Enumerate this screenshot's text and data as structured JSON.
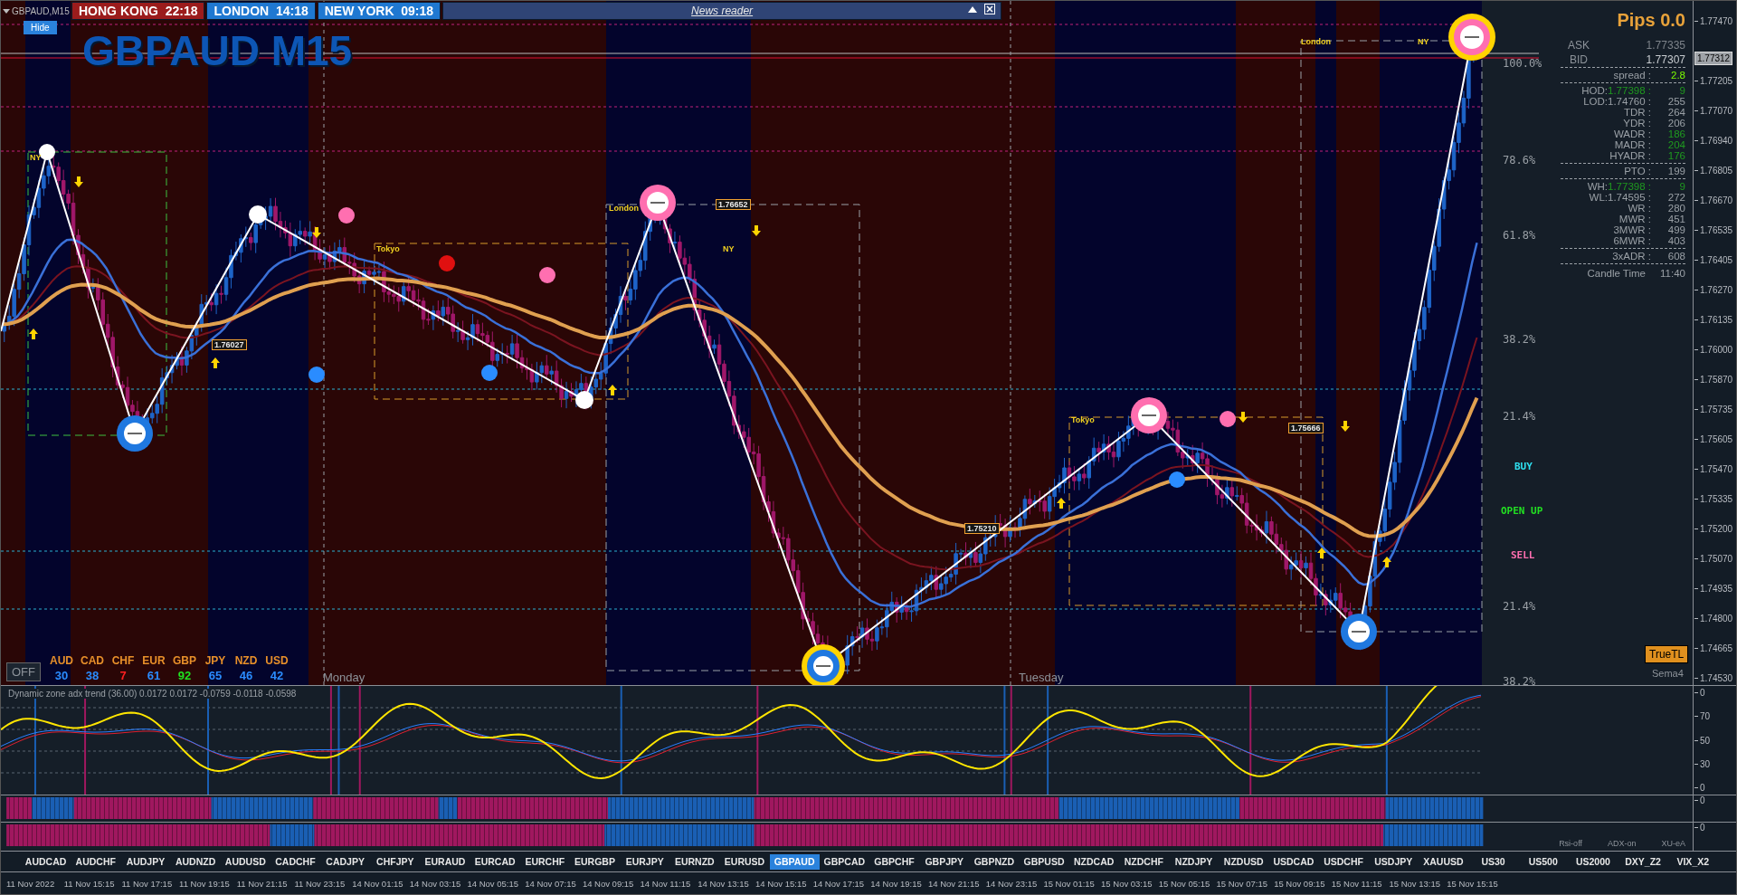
{
  "window": {
    "title": "GBPAUD,M15"
  },
  "clocks": [
    {
      "city": "HONG KONG",
      "time": "22:18",
      "color": "#9b1c1c"
    },
    {
      "city": "LONDON",
      "time": "14:18",
      "color": "#1f78d1"
    },
    {
      "city": "NEW YORK",
      "time": "09:18",
      "color": "#1f78d1"
    }
  ],
  "news_reader": {
    "title": "News reader"
  },
  "hide_button": "Hide",
  "chart": {
    "title": "GBPAUD M15",
    "labels": [
      {
        "text": "NY",
        "kind": "session"
      },
      {
        "text": "Tokyo",
        "kind": "session"
      },
      {
        "text": "London",
        "kind": "session"
      },
      {
        "text": "NY",
        "kind": "session"
      },
      {
        "text": "Tokyo",
        "kind": "session"
      },
      {
        "text": "London",
        "kind": "session"
      },
      {
        "text": "NY",
        "kind": "session"
      },
      {
        "text": "1.76027",
        "kind": "price"
      },
      {
        "text": "1.76652",
        "kind": "price"
      },
      {
        "text": "1.75210",
        "kind": "price"
      },
      {
        "text": "1.75666",
        "kind": "price"
      }
    ],
    "fib_levels": [
      "100.0%",
      "78.6%",
      "61.8%",
      "38.2%",
      "21.4%",
      "21.4%",
      "38.2%"
    ],
    "signals": [
      {
        "text": "BUY",
        "color": "#2fe0f0"
      },
      {
        "text": "OPEN UP",
        "color": "#22e022"
      },
      {
        "text": "SELL",
        "color": "#ff6fb0"
      }
    ],
    "days": [
      "Monday",
      "Tuesday"
    ],
    "off_button": "OFF",
    "true_tl_button": "TrueTL",
    "sema_label": "Sema4"
  },
  "info_panel": {
    "pips": "Pips 0.0",
    "ask": {
      "label": "ASK",
      "value": "1.77335"
    },
    "bid": {
      "label": "BID",
      "value": "1.77307"
    },
    "groups": [
      [
        {
          "label": "spread :",
          "value": "2.8",
          "color": "#7cfc00"
        }
      ],
      [
        {
          "label": "HOD:",
          "price": "1.77398 :",
          "value": "9",
          "color": "#1f9a1f"
        },
        {
          "label": "LOD:",
          "price": "1.74760 :",
          "value": "255",
          "color": "#9aa0a6"
        },
        {
          "label": "TDR :",
          "value": "264",
          "color": "#9aa0a6"
        },
        {
          "label": "YDR :",
          "value": "206",
          "color": "#9aa0a6"
        },
        {
          "label": "WADR :",
          "value": "186",
          "color": "#1f9a1f"
        },
        {
          "label": "MADR :",
          "value": "204",
          "color": "#1f9a1f"
        },
        {
          "label": "HYADR :",
          "value": "176",
          "color": "#1f9a1f"
        }
      ],
      [
        {
          "label": "PTO :",
          "value": "199",
          "color": "#9aa0a6"
        }
      ],
      [
        {
          "label": "WH:",
          "price": "1.77398 :",
          "value": "9",
          "color": "#1f9a1f"
        },
        {
          "label": "WL:",
          "price": "1.74595 :",
          "value": "272",
          "color": "#9aa0a6"
        },
        {
          "label": "WR :",
          "value": "280",
          "color": "#9aa0a6"
        },
        {
          "label": "MWR :",
          "value": "451",
          "color": "#9aa0a6"
        },
        {
          "label": "3MWR :",
          "value": "499",
          "color": "#9aa0a6"
        },
        {
          "label": "6MWR :",
          "value": "403",
          "color": "#9aa0a6"
        }
      ],
      [
        {
          "label": "3xADR :",
          "value": "608",
          "color": "#9aa0a6"
        }
      ]
    ],
    "candle_time": {
      "label": "Candle Time",
      "value": "11:40"
    }
  },
  "currency_strength": [
    {
      "code": "AUD",
      "value": "30",
      "color": "#2a8cff"
    },
    {
      "code": "CAD",
      "value": "38",
      "color": "#2a8cff"
    },
    {
      "code": "CHF",
      "value": "7",
      "color": "#ff2020"
    },
    {
      "code": "EUR",
      "value": "61",
      "color": "#2a8cff"
    },
    {
      "code": "GBP",
      "value": "92",
      "color": "#20e020"
    },
    {
      "code": "JPY",
      "value": "65",
      "color": "#2a8cff"
    },
    {
      "code": "NZD",
      "value": "46",
      "color": "#2a8cff"
    },
    {
      "code": "USD",
      "value": "42",
      "color": "#2a8cff"
    }
  ],
  "price_axis": [
    "1.77470",
    "1.77205",
    "1.77070",
    "1.76940",
    "1.76805",
    "1.76670",
    "1.76535",
    "1.76405",
    "1.76270",
    "1.76135",
    "1.76000",
    "1.75870",
    "1.75735",
    "1.75605",
    "1.75470",
    "1.75335",
    "1.75200",
    "1.75070",
    "1.74935",
    "1.74800",
    "1.74665",
    "1.74530"
  ],
  "current_price": "1.77312",
  "indicator": {
    "title": "Dynamic zone adx trend (36.00) 0.0172 0.0172 -0.0759 -0.0118 -0.0598",
    "axis": [
      "0",
      "70",
      "50",
      "30",
      "0"
    ]
  },
  "bar_panels": [
    {
      "axis": "0"
    },
    {
      "axis": "0",
      "toggles": [
        "Rsi-off",
        "ADX-on",
        "XU-eA"
      ]
    }
  ],
  "symbols": [
    {
      "label": "AUDCAD",
      "selected": false
    },
    {
      "label": "AUDCHF",
      "selected": false
    },
    {
      "label": "AUDJPY",
      "selected": false
    },
    {
      "label": "AUDNZD",
      "selected": false
    },
    {
      "label": "AUDUSD",
      "selected": false
    },
    {
      "label": "CADCHF",
      "selected": false
    },
    {
      "label": "CADJPY",
      "selected": false
    },
    {
      "label": "CHFJPY",
      "selected": false
    },
    {
      "label": "EURAUD",
      "selected": false
    },
    {
      "label": "EURCAD",
      "selected": false
    },
    {
      "label": "EURCHF",
      "selected": false
    },
    {
      "label": "EURGBP",
      "selected": false
    },
    {
      "label": "EURJPY",
      "selected": false
    },
    {
      "label": "EURNZD",
      "selected": false
    },
    {
      "label": "EURUSD",
      "selected": false
    },
    {
      "label": "GBPAUD",
      "selected": true
    },
    {
      "label": "GBPCAD",
      "selected": false
    },
    {
      "label": "GBPCHF",
      "selected": false
    },
    {
      "label": "GBPJPY",
      "selected": false
    },
    {
      "label": "GBPNZD",
      "selected": false
    },
    {
      "label": "GBPUSD",
      "selected": false
    },
    {
      "label": "NZDCAD",
      "selected": false
    },
    {
      "label": "NZDCHF",
      "selected": false
    },
    {
      "label": "NZDJPY",
      "selected": false
    },
    {
      "label": "NZDUSD",
      "selected": false
    },
    {
      "label": "USDCAD",
      "selected": false
    },
    {
      "label": "USDCHF",
      "selected": false
    },
    {
      "label": "USDJPY",
      "selected": false
    },
    {
      "label": "XAUUSD",
      "selected": false
    },
    {
      "label": "US30",
      "selected": false
    },
    {
      "label": "US500",
      "selected": false
    },
    {
      "label": "US2000",
      "selected": false
    },
    {
      "label": "DXY_Z2",
      "selected": false
    },
    {
      "label": "VIX_X2",
      "selected": false
    }
  ],
  "time_axis": [
    "11 Nov 2022",
    "11 Nov 15:15",
    "11 Nov 17:15",
    "11 Nov 19:15",
    "11 Nov 21:15",
    "11 Nov 23:15",
    "14 Nov 01:15",
    "14 Nov 03:15",
    "14 Nov 05:15",
    "14 Nov 07:15",
    "14 Nov 09:15",
    "14 Nov 11:15",
    "14 Nov 13:15",
    "14 Nov 15:15",
    "14 Nov 17:15",
    "14 Nov 19:15",
    "14 Nov 21:15",
    "14 Nov 23:15",
    "15 Nov 01:15",
    "15 Nov 03:15",
    "15 Nov 05:15",
    "15 Nov 07:15",
    "15 Nov 09:15",
    "15 Nov 11:15",
    "15 Nov 13:15",
    "15 Nov 15:15"
  ]
}
